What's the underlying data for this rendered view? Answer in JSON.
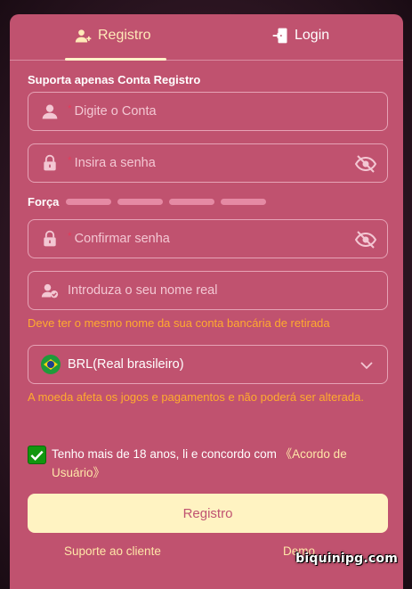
{
  "tabs": {
    "register": "Registro",
    "login": "Login"
  },
  "form": {
    "supported_label": "Suporta apenas Conta Registro",
    "account_placeholder": "Digite o Conta",
    "password_placeholder": "Insira a senha",
    "strength_label": "Força",
    "confirm_placeholder": "Confirmar senha",
    "realname_placeholder": "Introduza o seu nome real",
    "realname_warning": "Deve ter o mesmo nome da sua conta bancária de retirada",
    "currency_value": "BRL(Real brasileiro)",
    "currency_warning": "A moeda afeta os jogos e pagamentos e não poderá ser alterada.",
    "required_mark": "*",
    "agree_text": "Tenho mais de 18 anos, li e concordo com ",
    "agree_link": "《Acordo de Usuário》",
    "agree_checked": true,
    "submit_label": "Registro"
  },
  "footer": {
    "support": "Suporte ao cliente",
    "demo": "Demo"
  },
  "watermark": "biquinipg.com",
  "colors": {
    "panel": "#c0526f",
    "accent": "#fff3c2",
    "warning": "#ffab2e",
    "checkbox": "#12960f"
  },
  "icons": [
    "user-add-icon",
    "login-door-icon",
    "user-icon",
    "lock-icon",
    "eye-off-icon",
    "user-check-icon",
    "brazil-flag-icon",
    "chevron-down-icon",
    "checkmark-icon"
  ]
}
